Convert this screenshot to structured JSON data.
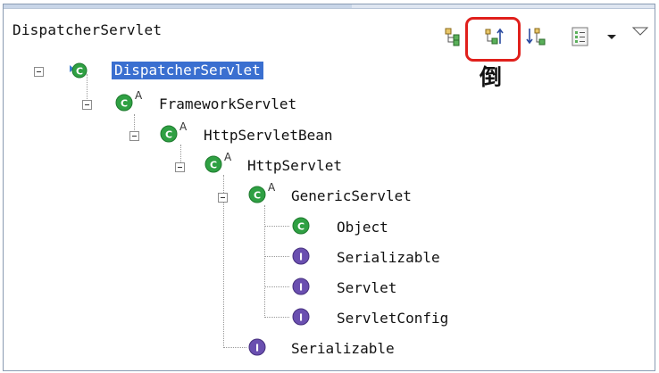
{
  "view": {
    "title": "DispatcherServlet"
  },
  "toolbar": {
    "tooltip": "倒",
    "buttons": [
      {
        "name": "show-type-hierarchy-button",
        "icon": "type-hierarchy-icon"
      },
      {
        "name": "show-supertype-hierarchy-button",
        "icon": "supertype-hierarchy-icon",
        "highlighted": true
      },
      {
        "name": "show-subtype-hierarchy-button",
        "icon": "subtype-hierarchy-icon"
      },
      {
        "name": "history-button",
        "icon": "history-list-icon"
      },
      {
        "name": "view-menu-button",
        "icon": "dropdown-triangle-icon"
      },
      {
        "name": "minimize-button",
        "icon": "minimize-triangle-icon"
      }
    ]
  },
  "tree": [
    {
      "label": "DispatcherServlet",
      "kind": "class-focus",
      "selected": true
    },
    {
      "label": "FrameworkServlet",
      "kind": "abstract-class"
    },
    {
      "label": "HttpServletBean",
      "kind": "abstract-class"
    },
    {
      "label": "HttpServlet",
      "kind": "abstract-class"
    },
    {
      "label": "GenericServlet",
      "kind": "abstract-class"
    },
    {
      "label": "Object",
      "kind": "class"
    },
    {
      "label": "Serializable",
      "kind": "interface"
    },
    {
      "label": "Servlet",
      "kind": "interface"
    },
    {
      "label": "ServletConfig",
      "kind": "interface"
    },
    {
      "label": "Serializable",
      "kind": "interface"
    }
  ],
  "badges": {
    "abstract": "A",
    "interface": "I"
  },
  "colors": {
    "selection": "#3a6fd0",
    "highlight": "#e0201c",
    "class": "#2fa043",
    "interface": "#6a4fb0"
  }
}
